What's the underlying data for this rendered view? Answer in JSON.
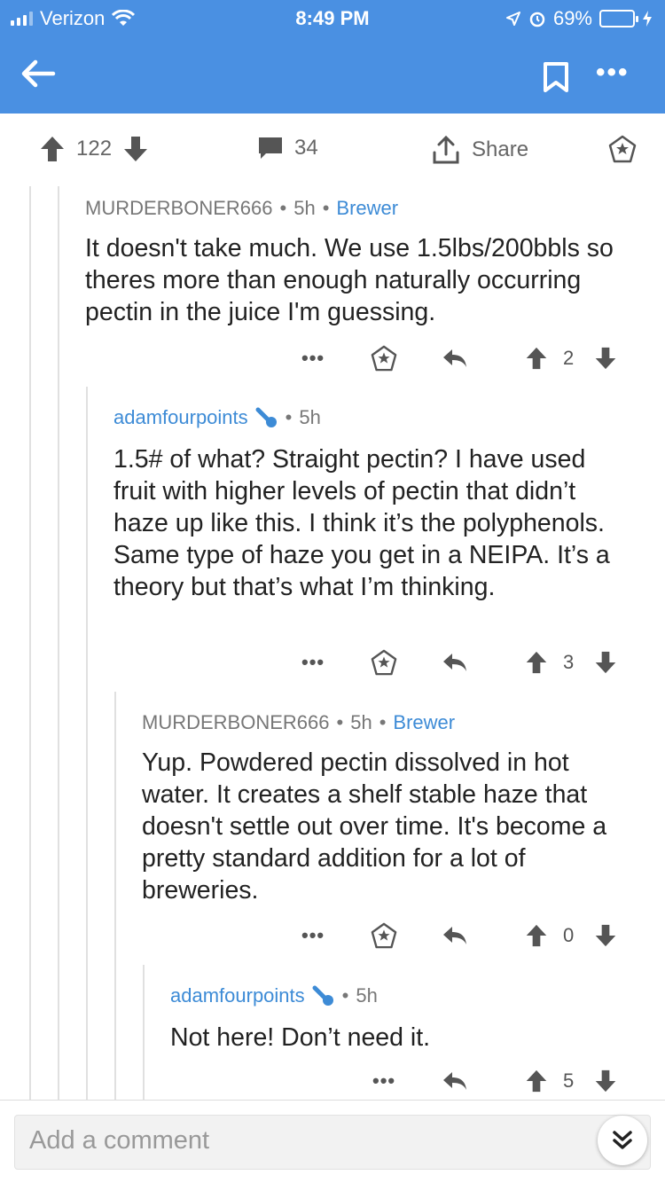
{
  "status_bar": {
    "carrier": "Verizon",
    "time": "8:49 PM",
    "battery": "69%"
  },
  "post_actions": {
    "upvotes": "122",
    "comments": "34",
    "share_label": "Share"
  },
  "comments": [
    {
      "author": "MURDERBONER666",
      "age": "5h",
      "flair": "Brewer",
      "text": "It doesn't take much. We use 1.5lbs/200bbls so theres more than enough naturally occurring pectin in the juice I'm guessing.",
      "score": "2"
    },
    {
      "author": "adamfourpoints",
      "age": "5h",
      "text": "1.5# of what? Straight pectin? I have used fruit with higher levels of pectin that didn’t haze up like this. I think it’s the polyphenols. Same type of haze you get in a NEIPA. It’s a theory but that’s what I’m thinking.",
      "score": "3"
    },
    {
      "author": "MURDERBONER666",
      "age": "5h",
      "flair": "Brewer",
      "text": "Yup. Powdered pectin dissolved in hot water. It creates a shelf stable haze that doesn't settle out over time. It's become a pretty standard addition for a lot of breweries.",
      "score": "0"
    },
    {
      "author": "adamfourpoints",
      "age": "5h",
      "text": "Not here! Don’t need it.",
      "score": "5"
    }
  ],
  "composer": {
    "placeholder": "Add a comment"
  },
  "colors": {
    "header": "#4a90e2",
    "link": "#3d8bd6",
    "battery_fill": "#f5c518"
  }
}
